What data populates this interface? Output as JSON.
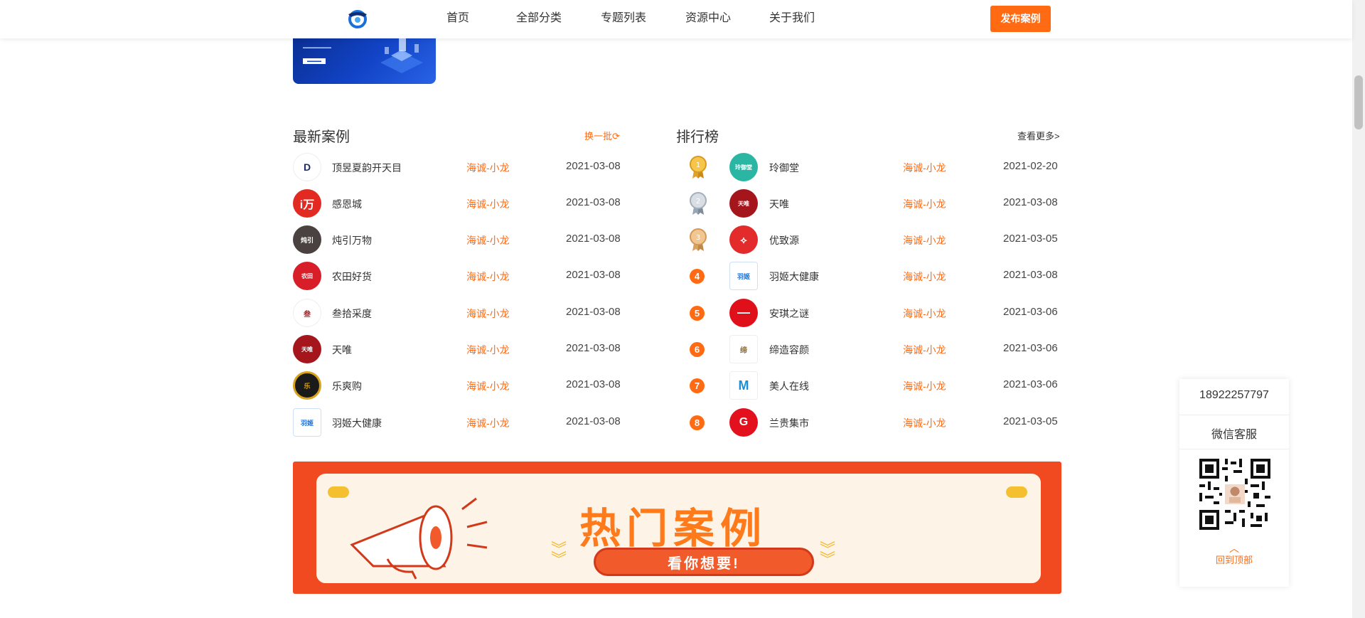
{
  "nav": {
    "items": [
      "首页",
      "全部分类",
      "专题列表",
      "资源中心",
      "关于我们"
    ],
    "publish_label": "发布案例"
  },
  "latest": {
    "title": "最新案例",
    "refresh_label": "换一批",
    "rows": [
      {
        "name": "顶昱夏韵开天目",
        "author": "海诚-小龙",
        "date": "2021-03-08"
      },
      {
        "name": "感恩城",
        "author": "海诚-小龙",
        "date": "2021-03-08"
      },
      {
        "name": "炖引万物",
        "author": "海诚-小龙",
        "date": "2021-03-08"
      },
      {
        "name": "农田好货",
        "author": "海诚-小龙",
        "date": "2021-03-08"
      },
      {
        "name": "叁拾采度",
        "author": "海诚-小龙",
        "date": "2021-03-08"
      },
      {
        "name": "天唯",
        "author": "海诚-小龙",
        "date": "2021-03-08"
      },
      {
        "name": "乐爽购",
        "author": "海诚-小龙",
        "date": "2021-03-08"
      },
      {
        "name": "羽姬大健康",
        "author": "海诚-小龙",
        "date": "2021-03-08"
      }
    ]
  },
  "ranking": {
    "title": "排行榜",
    "more_label": "查看更多>",
    "rows": [
      {
        "rank": "1",
        "name": "玲御堂",
        "author": "海诚-小龙",
        "date": "2021-02-20"
      },
      {
        "rank": "2",
        "name": "天唯",
        "author": "海诚-小龙",
        "date": "2021-03-08"
      },
      {
        "rank": "3",
        "name": "优致源",
        "author": "海诚-小龙",
        "date": "2021-03-05"
      },
      {
        "rank": "4",
        "name": "羽姬大健康",
        "author": "海诚-小龙",
        "date": "2021-03-08"
      },
      {
        "rank": "5",
        "name": "安琪之谜",
        "author": "海诚-小龙",
        "date": "2021-03-06"
      },
      {
        "rank": "6",
        "name": "缔造容颜",
        "author": "海诚-小龙",
        "date": "2021-03-06"
      },
      {
        "rank": "7",
        "name": "美人在线",
        "author": "海诚-小龙",
        "date": "2021-03-06"
      },
      {
        "rank": "8",
        "name": "兰贵集市",
        "author": "海诚-小龙",
        "date": "2021-03-05"
      }
    ]
  },
  "hot_banner": {
    "title": "热门案例",
    "subtitle": "看你想要!"
  },
  "side": {
    "phone": "18922257797",
    "wechat_label": "微信客服",
    "back_top_label": "回到顶部"
  },
  "colors": {
    "accent": "#ff6a13",
    "banner_red": "#f14a20"
  }
}
